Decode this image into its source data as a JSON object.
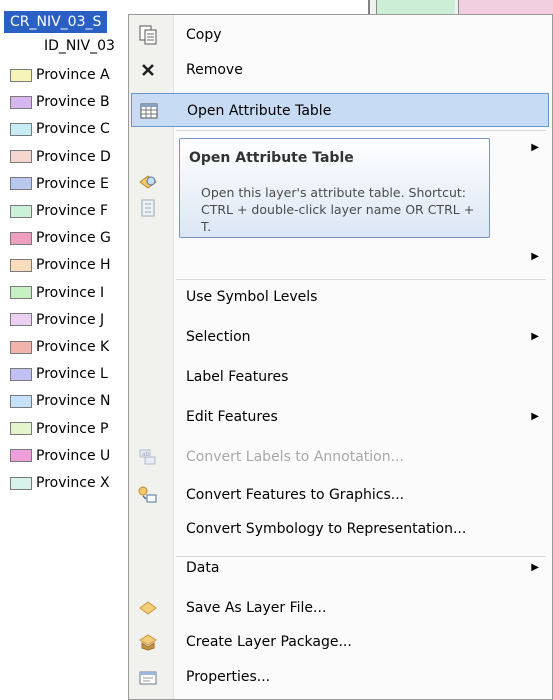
{
  "toc": {
    "layer_name": "CR_NIV_03_S",
    "field_name": "ID_NIV_03",
    "items": [
      {
        "label": "Province A",
        "color": "#f6f4b8"
      },
      {
        "label": "Province B",
        "color": "#d6b6ef"
      },
      {
        "label": "Province C",
        "color": "#c8ecf4"
      },
      {
        "label": "Province D",
        "color": "#f3d6cd"
      },
      {
        "label": "Province  E",
        "color": "#b9c8ef"
      },
      {
        "label": "Province F",
        "color": "#cdf0d8"
      },
      {
        "label": "Province G",
        "color": "#ee9fbd"
      },
      {
        "label": "Province H",
        "color": "#f8dcbb"
      },
      {
        "label": "Province I",
        "color": "#c6efc4"
      },
      {
        "label": "Province J",
        "color": "#ecd0f2"
      },
      {
        "label": "Province K",
        "color": "#f1b4ad"
      },
      {
        "label": "Province L",
        "color": "#c1c0f2"
      },
      {
        "label": "Province N",
        "color": "#c6e2fa"
      },
      {
        "label": "Province P",
        "color": "#e4f4cc"
      },
      {
        "label": "Province U",
        "color": "#ee9fd9"
      },
      {
        "label": "Province X",
        "color": "#d8f3ec"
      }
    ]
  },
  "menu": {
    "items": [
      {
        "label": "Copy",
        "icon": "copy-icon"
      },
      {
        "label": "Remove",
        "icon": "remove-icon"
      },
      {
        "label": "Open Attribute Table",
        "icon": "table-icon",
        "highlighted": true
      },
      {
        "label": "",
        "icon": "",
        "submenu": true
      },
      {
        "label": "",
        "icon": "zoom-layer-icon"
      },
      {
        "label": "",
        "icon": "zoom-visible-icon"
      },
      {
        "label": "",
        "icon": "",
        "submenu": true
      },
      {
        "label": "Use Symbol Levels",
        "icon": ""
      },
      {
        "label": "Selection",
        "icon": "",
        "submenu": true
      },
      {
        "label": "Label Features",
        "icon": ""
      },
      {
        "label": "Edit Features",
        "icon": "",
        "submenu": true
      },
      {
        "label": "Convert Labels to Annotation...",
        "icon": "convert-labels-icon",
        "disabled": true
      },
      {
        "label": "Convert Features to Graphics...",
        "icon": "convert-graphics-icon"
      },
      {
        "label": "Convert Symbology to Representation...",
        "icon": ""
      },
      {
        "label": "Data",
        "icon": "",
        "submenu": true
      },
      {
        "label": "Save As Layer File...",
        "icon": "layer-file-icon"
      },
      {
        "label": "Create Layer Package...",
        "icon": "layer-package-icon"
      },
      {
        "label": "Properties...",
        "icon": "properties-icon"
      }
    ]
  },
  "tooltip": {
    "title": "Open Attribute Table",
    "body": "Open this layer's attribute table. Shortcut: CTRL + double-click layer name OR CTRL + T."
  }
}
